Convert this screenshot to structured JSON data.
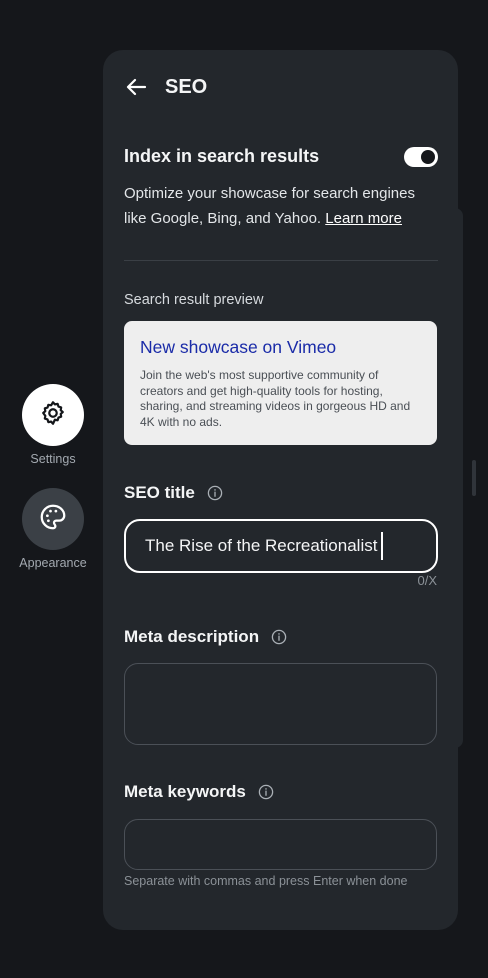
{
  "rail": {
    "settings_label": "Settings",
    "appearance_label": "Appearance"
  },
  "panel": {
    "title": "SEO",
    "index": {
      "title": "Index in search results",
      "enabled": true,
      "desc_line1": "Optimize your showcase for search engines",
      "desc_line2": "like Google, Bing, and Yahoo.",
      "learn_more": "Learn more"
    },
    "preview": {
      "label": "Search result preview",
      "title": "New showcase on Vimeo",
      "description": "Join the web's most supportive community of creators and get high-quality tools for hosting, sharing, and streaming videos in gorgeous HD and 4K with no ads."
    },
    "seo_title": {
      "label": "SEO title",
      "value": "The Rise of the Recreationalist",
      "counter": "0/X"
    },
    "meta_description": {
      "label": "Meta description",
      "value": ""
    },
    "meta_keywords": {
      "label": "Meta keywords",
      "value": "",
      "hint": "Separate with commas and press Enter when done"
    }
  },
  "colors": {
    "background": "#15171b",
    "panel": "#23272c",
    "link": "#1a2ba8",
    "preview_card": "#eeeeee"
  },
  "icons": {
    "back": "arrow-left-icon",
    "settings": "gear-icon",
    "appearance": "palette-icon",
    "info": "info-icon"
  }
}
